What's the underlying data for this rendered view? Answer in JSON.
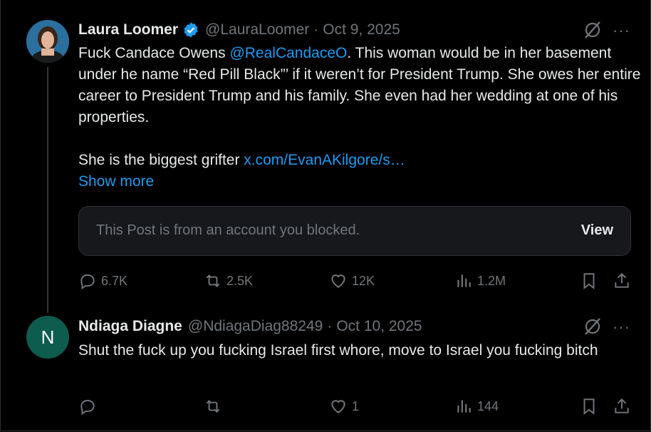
{
  "tweet1": {
    "name": "Laura Loomer",
    "handle": "@LauraLoomer",
    "dot": "·",
    "date": "Oct 9, 2025",
    "text_part1": "Fuck Candace Owens ",
    "mention": "@RealCandaceO",
    "text_part2": ". This woman would be in her basement under he name “Red Pill Black”’ if it weren’t for President Trump. She owes her entire career to President Trump and his family. She even had her wedding at one of his properties.",
    "text_part3": "She is the biggest grifter ",
    "link": "x.com/EvanAKilgore/s…",
    "show_more": "Show more",
    "blocked_notice": "This Post is from an account you blocked.",
    "view_label": "View",
    "replies": "6.7K",
    "reposts": "2.5K",
    "likes": "12K",
    "views": "1.2M",
    "more_icon": "···"
  },
  "tweet2": {
    "avatar_letter": "N",
    "name": "Ndiaga Diagne",
    "handle": "@NdiagaDiag88249",
    "dot": "·",
    "date": "Oct 10, 2025",
    "text": "Shut the fuck up you fucking Israel first whore, move to Israel you fucking bitch",
    "likes": "1",
    "views": "144",
    "more_icon": "···"
  },
  "colors": {
    "background": "#000000",
    "text": "#e7e9ea",
    "muted": "#71767b",
    "link": "#1d9bf0",
    "avatar2": "#0e5c4e"
  }
}
